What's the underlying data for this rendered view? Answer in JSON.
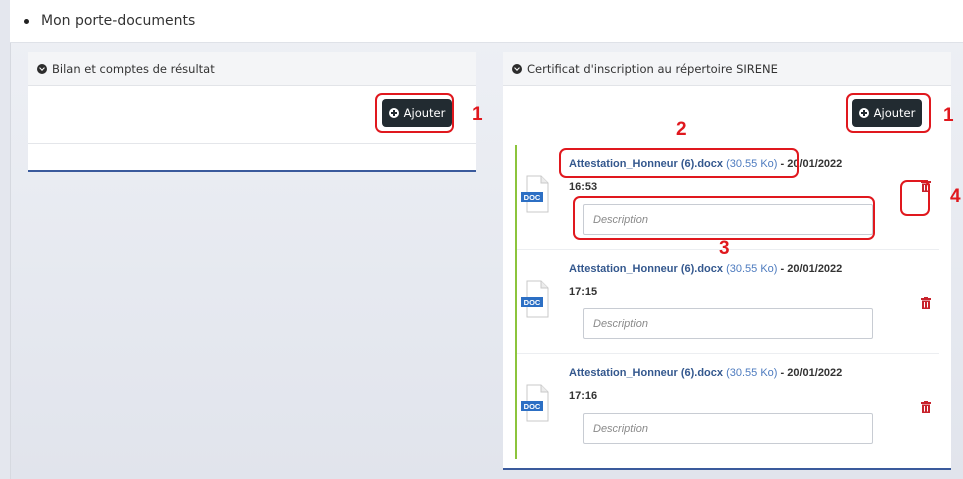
{
  "header": {
    "title": "Mon porte-documents"
  },
  "left_panel": {
    "title": "Bilan et comptes de résultat",
    "add_label": "Ajouter"
  },
  "right_panel": {
    "title": "Certificat d'inscription au répertoire SIRENE",
    "add_label": "Ajouter",
    "files": [
      {
        "name": "Attestation_Honneur (6).docx",
        "size": "(30.55 Ko)",
        "sep": " - ",
        "date": "20/01/2022",
        "time": "16:53",
        "badge": "DOC",
        "placeholder": "Description"
      },
      {
        "name": "Attestation_Honneur (6).docx",
        "size": "(30.55 Ko)",
        "sep": " - ",
        "date": "20/01/2022",
        "time": "17:15",
        "badge": "DOC",
        "placeholder": "Description"
      },
      {
        "name": "Attestation_Honneur (6).docx",
        "size": "(30.55 Ko)",
        "sep": " - ",
        "date": "20/01/2022",
        "time": "17:16",
        "badge": "DOC",
        "placeholder": "Description"
      }
    ]
  },
  "annotations": {
    "n1": "1",
    "n2": "2",
    "n3": "3",
    "n4": "4"
  },
  "colors": {
    "accent_blue": "#3a5a9c",
    "button_dark": "#222b31",
    "annotation_red": "#e0181e",
    "delete_red": "#c8232c",
    "link_blue": "#34588e",
    "row_border_green": "#8cc43c"
  }
}
